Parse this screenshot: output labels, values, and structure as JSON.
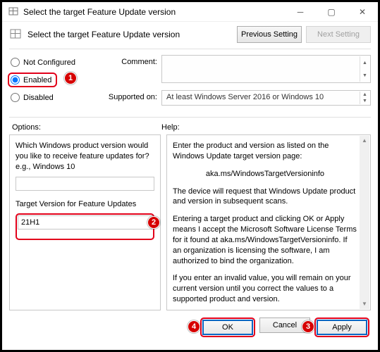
{
  "titlebar": {
    "title": "Select the target Feature Update version"
  },
  "header": {
    "title": "Select the target Feature Update version",
    "prev": "Previous Setting",
    "next": "Next Setting"
  },
  "state": {
    "not_configured": "Not Configured",
    "enabled": "Enabled",
    "disabled": "Disabled"
  },
  "fields": {
    "comment_label": "Comment:",
    "comment_value": "",
    "supported_label": "Supported on:",
    "supported_value": "At least Windows Server 2016 or Windows 10"
  },
  "section_labels": {
    "options": "Options:",
    "help": "Help:"
  },
  "options": {
    "q1": "Which Windows product version would you like to receive feature updates for? e.g., Windows 10",
    "v1": "",
    "q2": "Target Version for Feature Updates",
    "v2": "21H1"
  },
  "help": {
    "p1": "Enter the product and version as listed on the Windows Update target version page:",
    "link": "aka.ms/WindowsTargetVersioninfo",
    "p2": "The device will request that Windows Update product and version in subsequent scans.",
    "p3": "Entering a target product and clicking OK or Apply means I accept the Microsoft Software License Terms for it found at aka.ms/WindowsTargetVersioninfo. If an organization is licensing the software, I am authorized to bind the organization.",
    "p4": "If you enter an invalid value, you will remain on your current version until you correct the values to a supported product and version."
  },
  "buttons": {
    "ok": "OK",
    "cancel": "Cancel",
    "apply": "Apply"
  },
  "annotations": {
    "a1": "1",
    "a2": "2",
    "a3": "3",
    "a4": "4"
  }
}
